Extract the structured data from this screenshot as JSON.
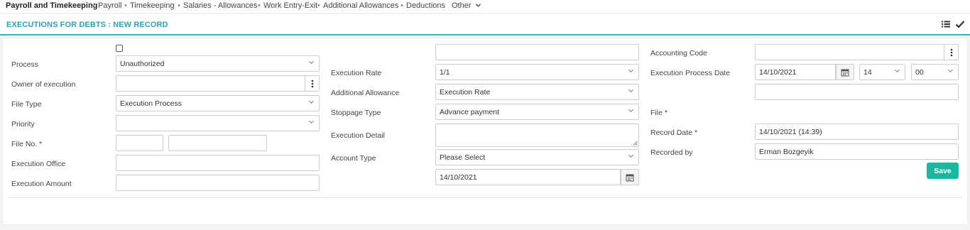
{
  "nav": {
    "brand": "Payroll and Timekeeping",
    "items": [
      "Payroll",
      "Timekeeping",
      "Salaries - Allowances",
      "Work Entry-Exit",
      "Additional Allowances",
      "Deductions"
    ],
    "other": "Other"
  },
  "page": {
    "title": "EXECUTIONS FOR DEBTS : NEW RECORD"
  },
  "form": {
    "process": {
      "label": "Process",
      "value": "Unauthorized"
    },
    "owner": {
      "label": "Owner of execution",
      "value": ""
    },
    "file_type": {
      "label": "File Type",
      "value": "Execution Process"
    },
    "priority": {
      "label": "Priority",
      "value": ""
    },
    "file_no": {
      "label": "File No. *",
      "value_a": "",
      "value_b": ""
    },
    "execution_office": {
      "label": "Execution Office",
      "value": ""
    },
    "execution_amount": {
      "label": "Execution Amount",
      "value": ""
    },
    "top_middle": {
      "value": ""
    },
    "execution_rate": {
      "label": "Execution Rate",
      "value": "1/1"
    },
    "additional_allowance": {
      "label": "Additional Allowance",
      "value": "Execution Rate"
    },
    "stoppage_type": {
      "label": "Stoppage Type",
      "value": "Advance payment"
    },
    "execution_detail": {
      "label": "Execution Detail",
      "value": ""
    },
    "account_type": {
      "label": "Account Type",
      "value": "Please Select"
    },
    "middle_date": {
      "value": "14/10/2021"
    },
    "accounting_code": {
      "label": "Accounting Code",
      "value": ""
    },
    "execution_process_date": {
      "label": "Execution Process Date",
      "date": "14/10/2021",
      "hour": "14",
      "minute": "00"
    },
    "extra_right": {
      "value": ""
    },
    "file": {
      "label": "File *"
    },
    "record_date": {
      "label": "Record Date *",
      "value": "14/10/2021 (14:39)"
    },
    "recorded_by": {
      "label": "Recorded by",
      "value": "Erman Bozgeyik"
    }
  },
  "actions": {
    "save": "Save"
  },
  "colors": {
    "accent": "#2e9fb0",
    "save": "#17b89f"
  }
}
